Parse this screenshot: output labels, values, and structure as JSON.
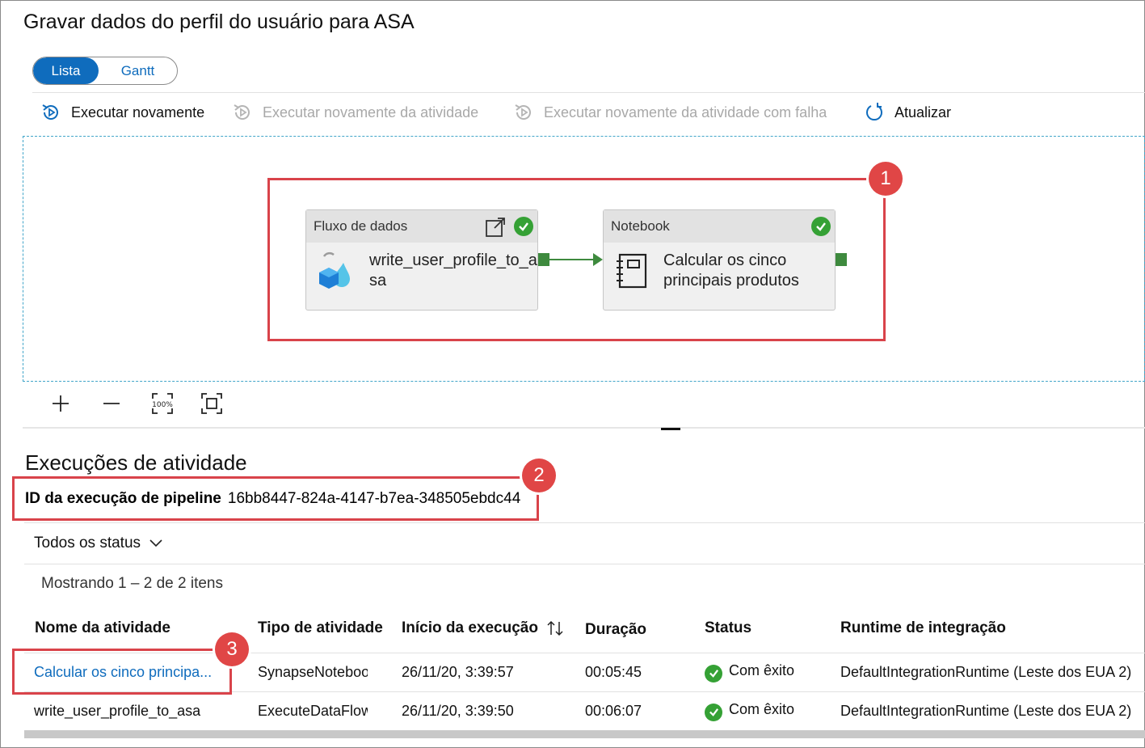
{
  "header": {
    "title": "Gravar dados do perfil do usuário para ASA"
  },
  "view_toggle": {
    "list_label": "Lista",
    "gantt_label": "Gantt",
    "selected": "Lista"
  },
  "toolbar": {
    "rerun_label": "Executar novamente",
    "rerun_from_activity_label": "Executar novamente da atividade",
    "rerun_failed_label": "Executar novamente da atividade com falha",
    "refresh_label": "Atualizar"
  },
  "canvas": {
    "nodes": [
      {
        "type_label": "Fluxo de dados",
        "name_line1": "write_user_profile_to_a",
        "name_line2": "sa",
        "status": "succeeded"
      },
      {
        "type_label": "Notebook",
        "name_line1": "Calcular os cinco",
        "name_line2": "principais produtos",
        "status": "succeeded"
      }
    ],
    "zoom_controls": [
      "zoom-in",
      "zoom-out",
      "zoom-100",
      "fit-to-screen"
    ],
    "zoom_100_label": "100%"
  },
  "annotations": {
    "badge1": "1",
    "badge2": "2",
    "badge3": "3"
  },
  "activity_runs": {
    "title": "Execuções de atividade",
    "pipeline_run_id_label": "ID da execução de pipeline",
    "pipeline_run_id": "16bb8447-824a-4147-b7ea-348505ebdc44",
    "status_filter": "Todos os status",
    "showing_text": "Mostrando 1 – 2 de 2 itens",
    "columns": {
      "name": "Nome da atividade",
      "type": "Tipo de atividade",
      "start": "Início da execução",
      "duration": "Duração",
      "status": "Status",
      "runtime": "Runtime de integração"
    },
    "rows": [
      {
        "name": "Calcular os cinco principa...",
        "type": "SynapseNotebook",
        "start": "26/11/20, 3:39:57",
        "duration": "00:05:45",
        "status": "Com êxito",
        "runtime": "DefaultIntegrationRuntime (Leste dos EUA 2)"
      },
      {
        "name": "write_user_profile_to_asa",
        "type": "ExecuteDataFlow",
        "start": "26/11/20, 3:39:50",
        "duration": "00:06:07",
        "status": "Com êxito",
        "runtime": "DefaultIntegrationRuntime (Leste dos EUA 2)"
      }
    ]
  },
  "colors": {
    "accent": "#0f6cbd",
    "success": "#35a135",
    "annotation": "#d9434a"
  }
}
